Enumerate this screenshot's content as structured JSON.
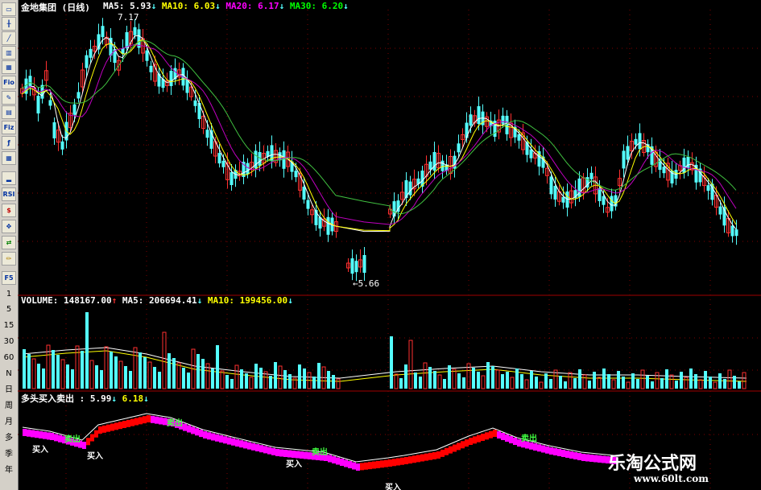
{
  "stock_title": "金地集团 (日线)",
  "main_indicators": [
    {
      "label": "MA5:",
      "value": "5.93",
      "arrow": "↓",
      "color": "#ffffff"
    },
    {
      "label": "MA10:",
      "value": "6.03",
      "arrow": "↓",
      "color": "#ffff00"
    },
    {
      "label": "MA20:",
      "value": "6.17",
      "arrow": "↓",
      "color": "#ff00ff"
    },
    {
      "label": "MA30:",
      "value": "6.20",
      "arrow": "↓",
      "color": "#00ff00"
    }
  ],
  "price_high_label": "7.17",
  "price_low_label": "←5.66",
  "volume_indicators": [
    {
      "label": "VOLUME:",
      "value": "148167.00",
      "arrow": "↑",
      "color": "#ffffff"
    },
    {
      "label": "MA5:",
      "value": "206694.41",
      "arrow": "↓",
      "color": "#ffffff"
    },
    {
      "label": "MA10:",
      "value": "199456.00",
      "arrow": "↓",
      "color": "#ffff00"
    }
  ],
  "signal_indicator": {
    "title": "多头买入卖出 :",
    "v1": "5.99",
    "a1": "↓",
    "v2": "6.18",
    "a2": "↓"
  },
  "signal_labels": {
    "sell": "卖出",
    "buy": "买入"
  },
  "toolbar": {
    "icon_buttons": [
      "page-icon",
      "candles-icon",
      "bars-icon",
      "line-icon",
      "calendar-icon",
      "candles-color-icon",
      "calc-icon",
      "fio-icon",
      "notepad-icon",
      "grid-icon",
      "fio2-icon",
      "formula-icon",
      "table-icon",
      "bars2-icon",
      "rsi-icon",
      "dollar-icon",
      "move-icon",
      "swap-icon",
      "pen-icon",
      "f5-icon"
    ],
    "labels": {
      "rsi": "RSI",
      "f5": "F5",
      "fio": "Fio",
      "fiz": "Fiz"
    },
    "period_numbers": [
      "1",
      "5",
      "15",
      "30",
      "60",
      "N"
    ],
    "period_words": [
      "日",
      "周",
      "月",
      "多",
      "季",
      "年"
    ]
  },
  "watermark": {
    "title": "乐淘公式网",
    "url": "www.60lt.com"
  },
  "colors": {
    "up": "#ff3030",
    "down": "#54ffff",
    "ma5": "#ffffff",
    "ma10": "#ffff00",
    "ma20": "#c000c0",
    "ma30": "#40c040",
    "grid": "#800000",
    "sig_up": "#ff0000",
    "sig_down": "#ff00ff"
  }
}
